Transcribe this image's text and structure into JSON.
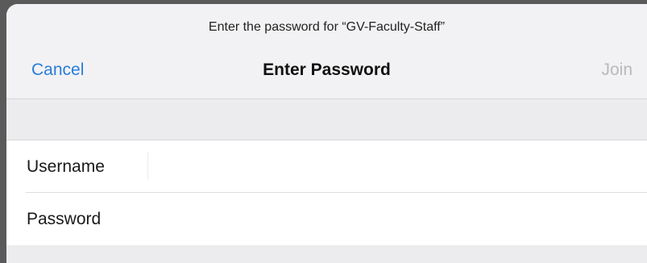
{
  "header": {
    "prompt": "Enter the password for “GV-Faculty-Staff”",
    "title": "Enter Password",
    "cancel_label": "Cancel",
    "join_label": "Join"
  },
  "form": {
    "username": {
      "label": "Username",
      "value": ""
    },
    "password": {
      "label": "Password",
      "value": ""
    }
  },
  "colors": {
    "accent": "#2a7dd8",
    "disabled": "#b9b9bd"
  }
}
